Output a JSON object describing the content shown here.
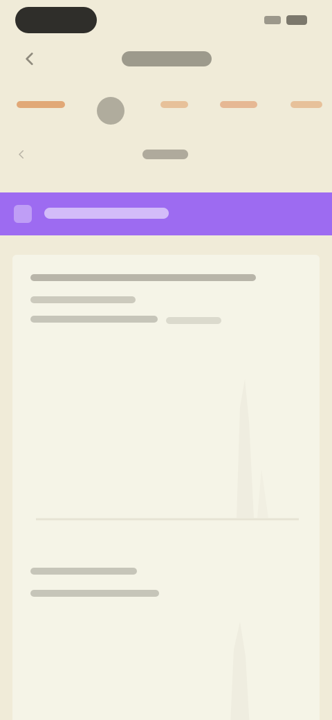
{
  "status_bar": {},
  "header": {},
  "tabs": [],
  "section": {},
  "banner": {
    "color": "#9D6BF1"
  },
  "card": {},
  "chart_data": [
    {
      "type": "line",
      "series": []
    },
    {
      "type": "line",
      "series": []
    }
  ]
}
